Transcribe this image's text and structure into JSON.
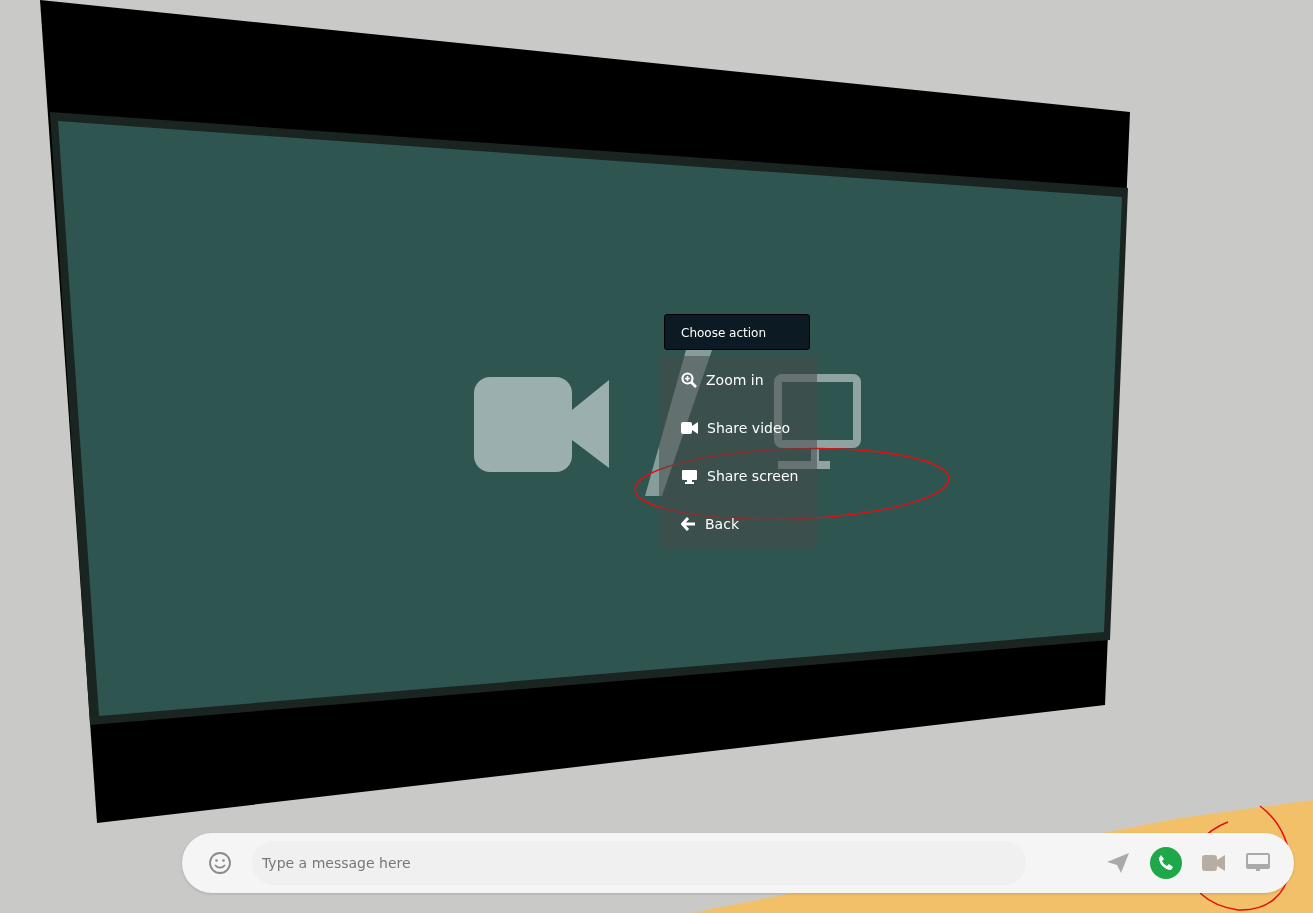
{
  "menu": {
    "title": "Choose action",
    "items": [
      {
        "label": "Zoom in",
        "kind": "zoom"
      },
      {
        "label": "Share video",
        "kind": "video"
      },
      {
        "label": "Share screen",
        "kind": "screen"
      },
      {
        "label": "Back",
        "kind": "back"
      }
    ]
  },
  "chat_bar": {
    "placeholder": "Type a message here"
  }
}
